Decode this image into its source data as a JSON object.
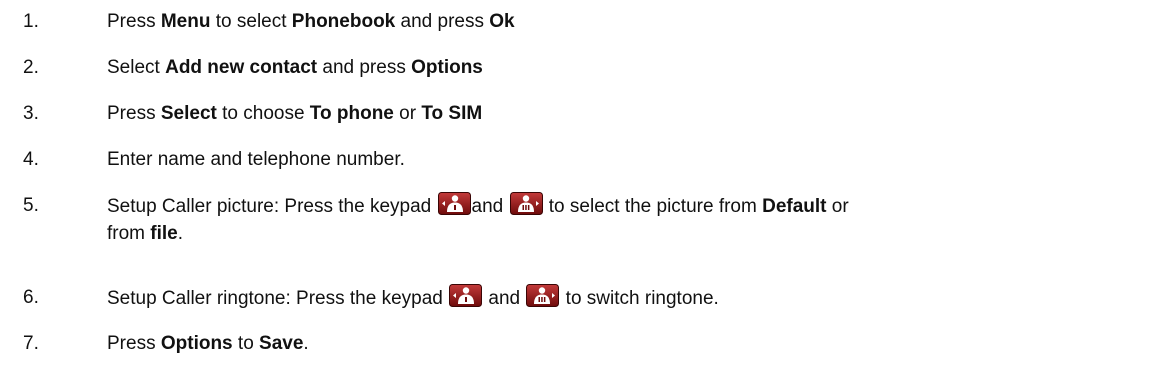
{
  "steps": [
    {
      "number": "1.",
      "t1": "Press ",
      "b1": "Menu",
      "t2": " to select ",
      "b2": "Phonebook",
      "t3": " and press ",
      "b3": "Ok"
    },
    {
      "number": "2.",
      "t1": "Select ",
      "b1": "Add new contact",
      "t2": " and press ",
      "b2": "Options"
    },
    {
      "number": "3.",
      "t1": "Press ",
      "b1": "Select",
      "t2": " to choose ",
      "b2": "To phone",
      "t3": " or ",
      "b3": "To SIM"
    },
    {
      "number": "4.",
      "t1": "Enter name and telephone number."
    },
    {
      "number": "5.",
      "t1": "Setup Caller picture: Press the keypad ",
      "t2": "and ",
      "t3": " to select the picture from ",
      "b1": "Default",
      "t4": " or",
      "t5": "from ",
      "b2": "file",
      "t6": "."
    },
    {
      "number": "6.",
      "t1": "Setup Caller ringtone: Press the keypad ",
      "t2": " and ",
      "t3": " to switch ringtone."
    },
    {
      "number": "7.",
      "t1": "Press ",
      "b1": "Options",
      "t2": " to ",
      "b2": "Save",
      "t3": "."
    }
  ],
  "icons": {
    "left_key": "keypad-left-icon",
    "right_key": "keypad-right-icon",
    "key_color": "#8f1414"
  }
}
